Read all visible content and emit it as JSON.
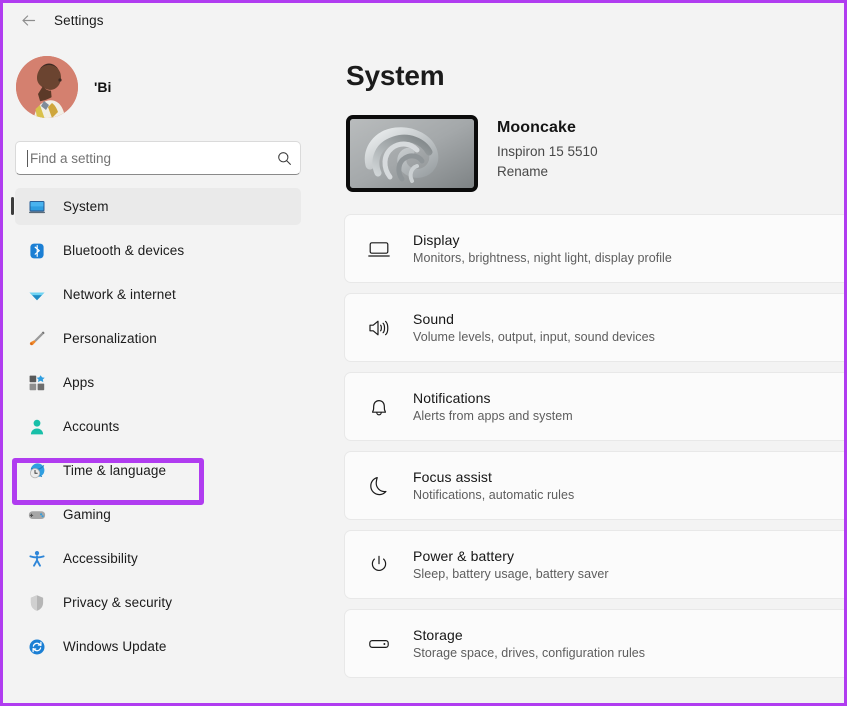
{
  "window": {
    "title": "Settings",
    "back_icon": "back-arrow-icon"
  },
  "colors": {
    "highlight": "#b03cf0",
    "page_background": "#f3f3f3",
    "card_background": "#fbfbfb",
    "accent_selected": "#eaeaea",
    "avatar_background": "#d4806f"
  },
  "sidebar": {
    "profile": {
      "name": "'Bi",
      "avatar_icon": "user-avatar-photo"
    },
    "search": {
      "placeholder": "Find a setting",
      "value": "",
      "icon": "search-icon"
    },
    "items": [
      {
        "label": "System",
        "icon": "monitor-icon",
        "selected": true
      },
      {
        "label": "Bluetooth & devices",
        "icon": "bluetooth-icon",
        "selected": false
      },
      {
        "label": "Network & internet",
        "icon": "wifi-icon",
        "selected": false
      },
      {
        "label": "Personalization",
        "icon": "paintbrush-icon",
        "selected": false
      },
      {
        "label": "Apps",
        "icon": "apps-grid-icon",
        "selected": false
      },
      {
        "label": "Accounts",
        "icon": "person-icon",
        "selected": false,
        "highlighted": true
      },
      {
        "label": "Time & language",
        "icon": "clock-globe-icon",
        "selected": false
      },
      {
        "label": "Gaming",
        "icon": "gamepad-icon",
        "selected": false
      },
      {
        "label": "Accessibility",
        "icon": "accessibility-icon",
        "selected": false
      },
      {
        "label": "Privacy & security",
        "icon": "shield-icon",
        "selected": false
      },
      {
        "label": "Windows Update",
        "icon": "update-refresh-icon",
        "selected": false
      }
    ]
  },
  "main": {
    "page_title": "System",
    "device": {
      "name": "Mooncake",
      "model": "Inspiron 15 5510",
      "rename_link": "Rename",
      "thumbnail_icon": "device-wallpaper-thumbnail"
    },
    "settings": [
      {
        "title": "Display",
        "subtitle": "Monitors, brightness, night light, display profile",
        "icon": "display-monitor-icon"
      },
      {
        "title": "Sound",
        "subtitle": "Volume levels, output, input, sound devices",
        "icon": "speaker-icon"
      },
      {
        "title": "Notifications",
        "subtitle": "Alerts from apps and system",
        "icon": "bell-icon"
      },
      {
        "title": "Focus assist",
        "subtitle": "Notifications, automatic rules",
        "icon": "moon-icon"
      },
      {
        "title": "Power & battery",
        "subtitle": "Sleep, battery usage, battery saver",
        "icon": "power-icon"
      },
      {
        "title": "Storage",
        "subtitle": "Storage space, drives, configuration rules",
        "icon": "storage-drive-icon"
      }
    ]
  }
}
